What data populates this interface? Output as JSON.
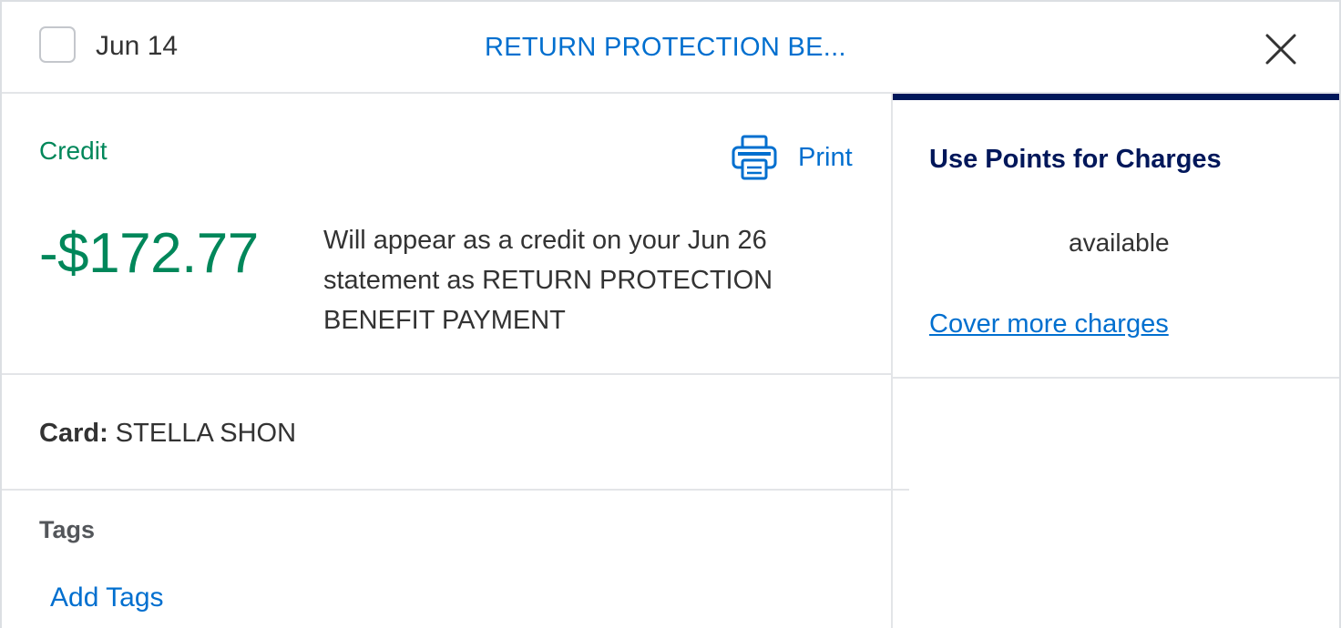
{
  "header": {
    "date": "Jun 14",
    "title": "RETURN PROTECTION BE...",
    "close_icon": "close-icon"
  },
  "transaction": {
    "type_label": "Credit",
    "print_label": "Print",
    "print_icon": "printer-icon",
    "amount": "-$172.77",
    "description": "Will appear as a credit on your Jun 26 statement as RETURN PROTECTION BENEFIT PAYMENT",
    "card_label": "Card:",
    "card_name": "STELLA SHON",
    "tags_heading": "Tags",
    "add_tags_label": "Add Tags"
  },
  "points": {
    "title": "Use Points for Charges",
    "available_text": "available",
    "cover_link": "Cover more charges"
  },
  "colors": {
    "brand_blue": "#006fcf",
    "navy": "#00175a",
    "credit_green": "#00875a"
  }
}
